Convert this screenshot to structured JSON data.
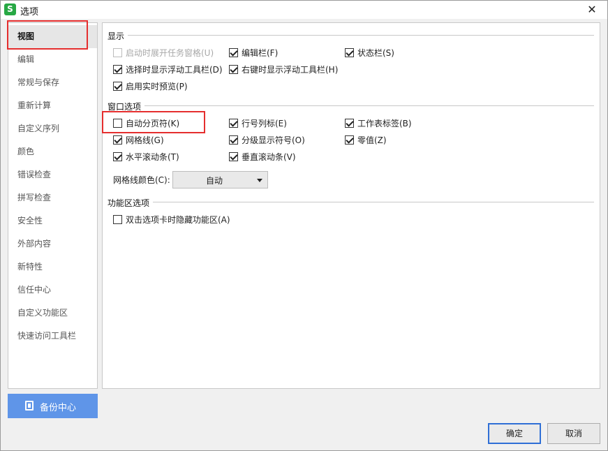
{
  "window": {
    "title": "选项",
    "app_icon_letter": "S"
  },
  "colors": {
    "accent": "#5f95e8",
    "highlight_box": "#e52e2e",
    "app_icon": "#27a844"
  },
  "icons": {
    "close": "close-icon",
    "backup": "backup-icon",
    "dropdown": "chevron-down-icon"
  },
  "nav": {
    "items": [
      {
        "label": "视图",
        "selected": true
      },
      {
        "label": "编辑"
      },
      {
        "label": "常规与保存"
      },
      {
        "label": "重新计算"
      },
      {
        "label": "自定义序列"
      },
      {
        "label": "颜色"
      },
      {
        "label": "错误检查"
      },
      {
        "label": "拼写检查"
      },
      {
        "label": "安全性"
      },
      {
        "label": "外部内容"
      },
      {
        "label": "新特性"
      },
      {
        "label": "信任中心"
      },
      {
        "label": "自定义功能区"
      },
      {
        "label": "快速访问工具栏"
      }
    ],
    "backup_label": "备份中心"
  },
  "display": {
    "title": "显示",
    "options": [
      {
        "label": "启动时展开任务窗格(U)",
        "checked": false,
        "disabled": true
      },
      {
        "label": "编辑栏(F)",
        "checked": true
      },
      {
        "label": "状态栏(S)",
        "checked": true
      },
      {
        "label": "选择时显示浮动工具栏(D)",
        "checked": true
      },
      {
        "label": "右键时显示浮动工具栏(H)",
        "checked": true
      },
      {
        "label": "启用实时预览(P)",
        "checked": true
      }
    ]
  },
  "window_options": {
    "title": "窗口选项",
    "options": [
      {
        "label": "自动分页符(K)",
        "checked": false
      },
      {
        "label": "行号列标(E)",
        "checked": true
      },
      {
        "label": "工作表标签(B)",
        "checked": true
      },
      {
        "label": "网格线(G)",
        "checked": true
      },
      {
        "label": "分级显示符号(O)",
        "checked": true
      },
      {
        "label": "零值(Z)",
        "checked": true
      },
      {
        "label": "水平滚动条(T)",
        "checked": true
      },
      {
        "label": "垂直滚动条(V)",
        "checked": true
      }
    ],
    "gridline_color_label": "网格线颜色(C):",
    "gridline_color_value": "自动"
  },
  "ribbon": {
    "title": "功能区选项",
    "options": [
      {
        "label": "双击选项卡时隐藏功能区(A)",
        "checked": false
      }
    ]
  },
  "buttons": {
    "ok": "确定",
    "cancel": "取消"
  }
}
